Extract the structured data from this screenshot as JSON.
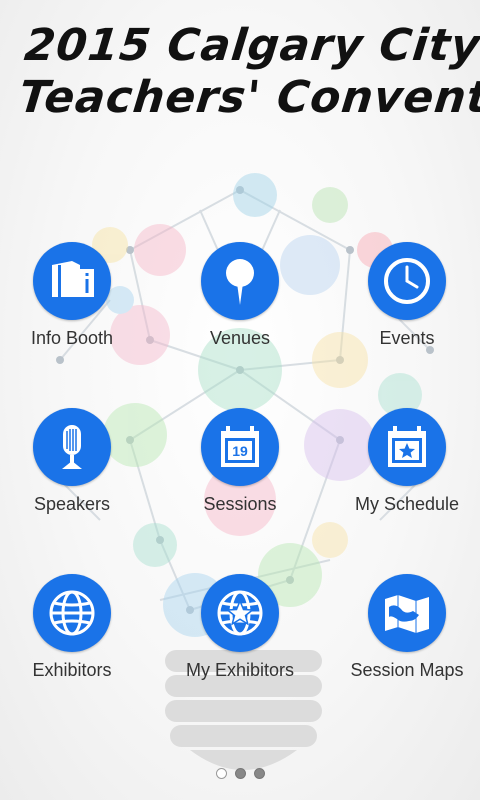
{
  "header": {
    "title_line1": "2015 Calgary City",
    "title_line2": "Teachers' Convention"
  },
  "colors": {
    "accent": "#1a73e8",
    "label": "#333333"
  },
  "menu": {
    "items": [
      {
        "label": "Info Booth",
        "icon": "info-booth-icon"
      },
      {
        "label": "Venues",
        "icon": "map-pin-icon"
      },
      {
        "label": "Events",
        "icon": "clock-icon"
      },
      {
        "label": "Speakers",
        "icon": "microphone-icon"
      },
      {
        "label": "Sessions",
        "icon": "calendar-19-icon"
      },
      {
        "label": "My Schedule",
        "icon": "calendar-star-icon"
      },
      {
        "label": "Exhibitors",
        "icon": "globe-icon"
      },
      {
        "label": "My Exhibitors",
        "icon": "globe-star-icon"
      },
      {
        "label": "Session Maps",
        "icon": "folded-map-icon"
      }
    ],
    "calendar_day": "19"
  },
  "pager": {
    "current_page": 1,
    "total_pages": 3
  }
}
